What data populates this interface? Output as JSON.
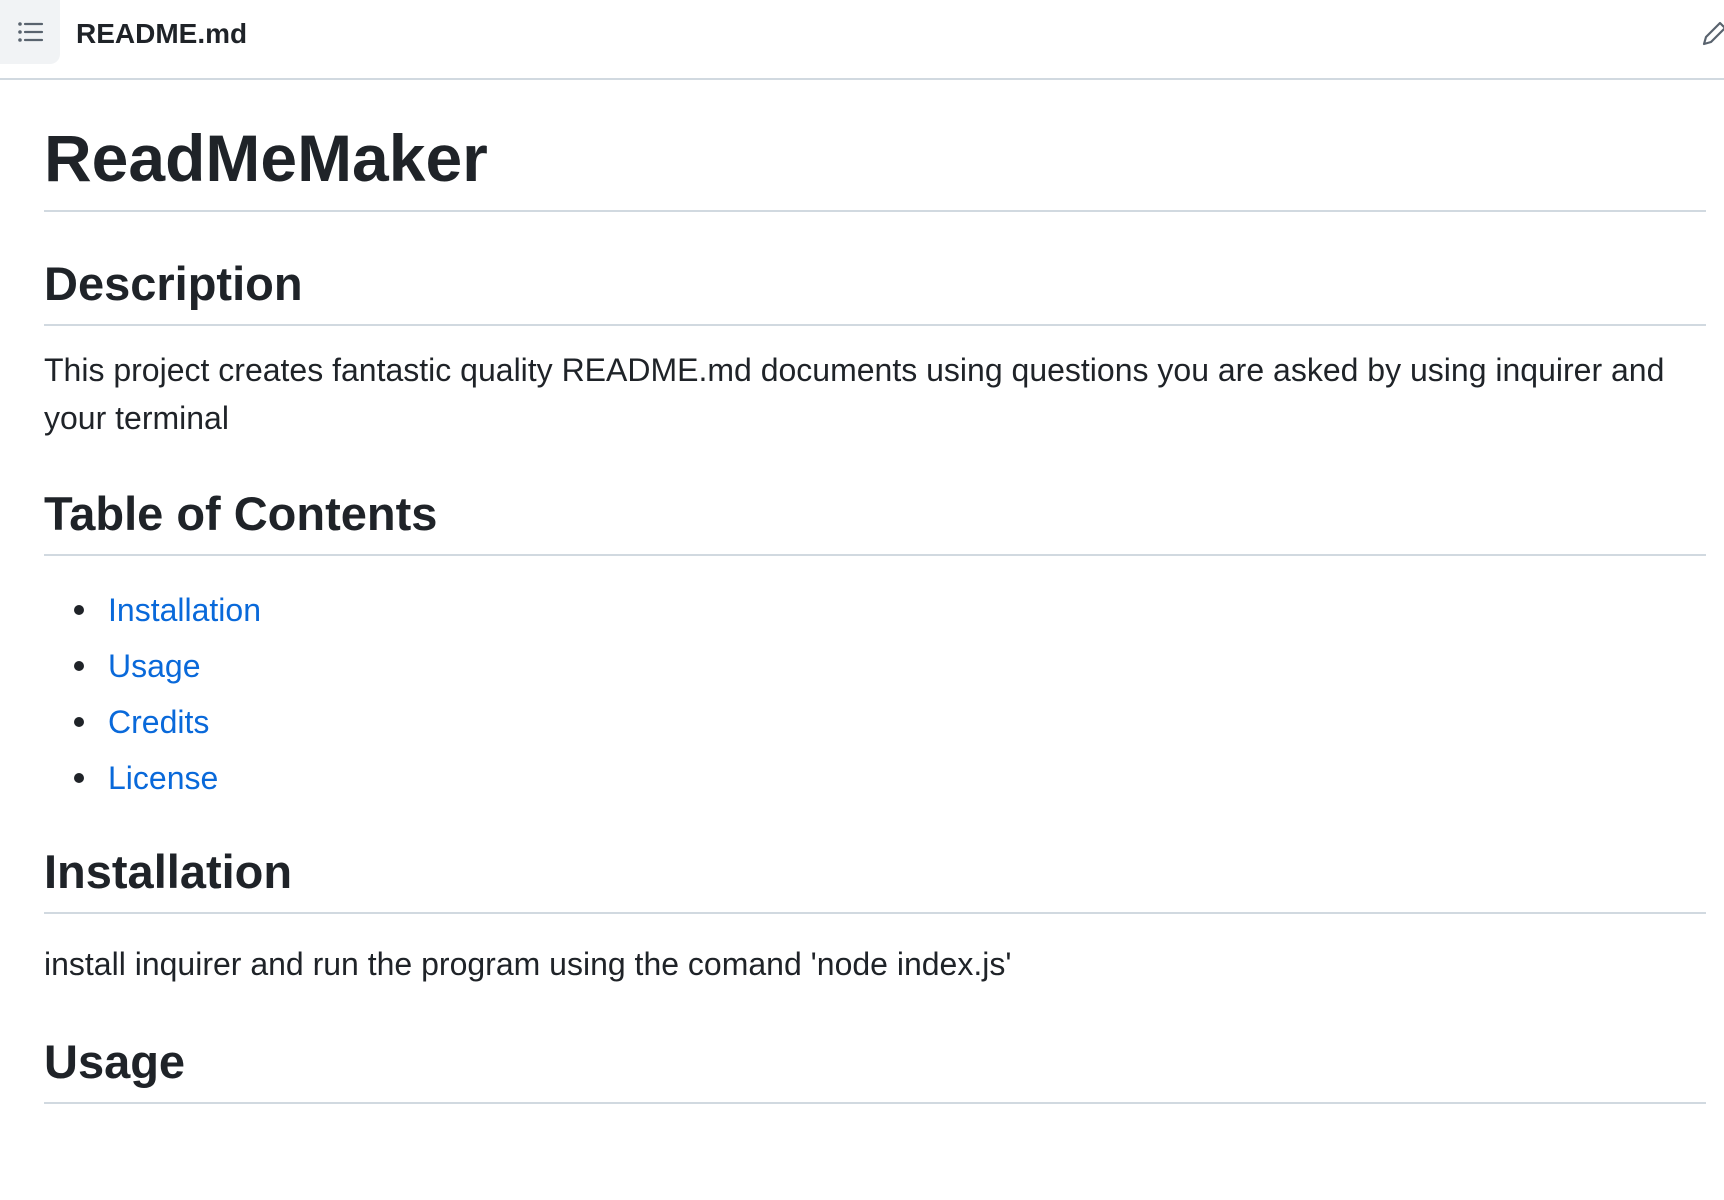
{
  "header": {
    "file_name": "README.md",
    "toc_icon": "list-unordered-icon",
    "edit_icon": "pencil-icon"
  },
  "readme": {
    "title": "ReadMeMaker",
    "description_heading": "Description",
    "description_text": "This project creates fantastic quality README.md documents using questions you are asked by using inquirer and your terminal",
    "toc_heading": "Table of Contents",
    "toc_items": [
      "Installation",
      "Usage",
      "Credits",
      "License"
    ],
    "installation_heading": "Installation",
    "installation_text": "install inquirer and run the program using the comand 'node index.js'",
    "usage_heading": "Usage"
  },
  "colors": {
    "text": "#1f2328",
    "link": "#0969da",
    "border": "#d1d9e0",
    "button_bg": "#f1f3f5"
  }
}
